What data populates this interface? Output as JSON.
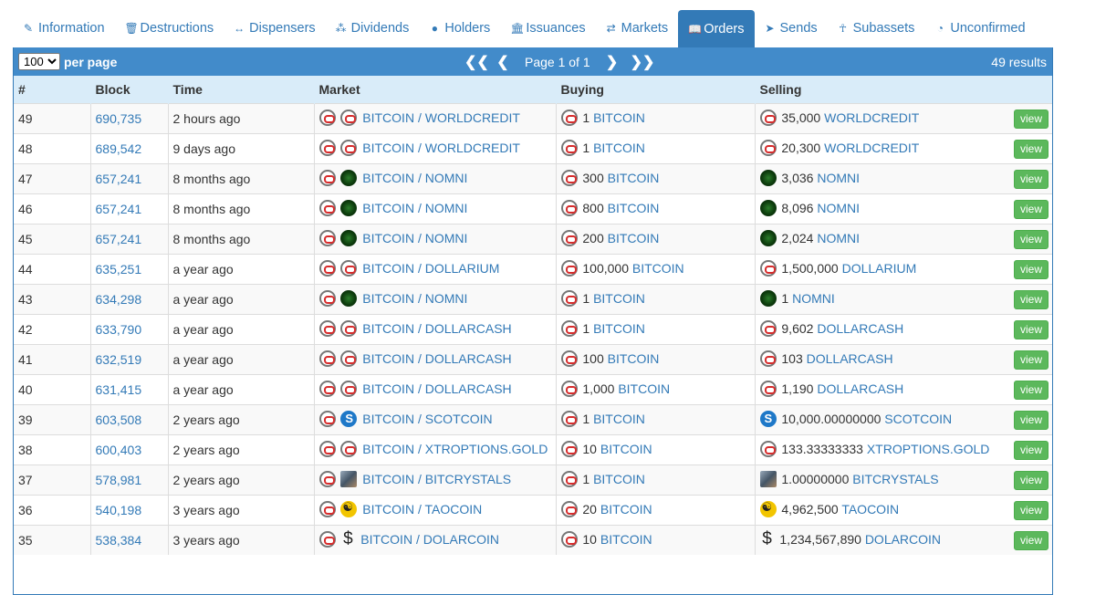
{
  "tabs": [
    {
      "label": "Information",
      "icon": "file-icon",
      "glyph": "✎"
    },
    {
      "label": "Destructions",
      "icon": "trash-icon",
      "glyph": "🗑"
    },
    {
      "label": "Dispensers",
      "icon": "arrows-h-icon",
      "glyph": "↔"
    },
    {
      "label": "Dividends",
      "icon": "sitemap-icon",
      "glyph": "⁂"
    },
    {
      "label": "Holders",
      "icon": "user-icon",
      "glyph": "●"
    },
    {
      "label": "Issuances",
      "icon": "bank-icon",
      "glyph": "🏛"
    },
    {
      "label": "Markets",
      "icon": "exchange-icon",
      "glyph": "⇄"
    },
    {
      "label": "Orders",
      "icon": "book-icon",
      "glyph": "📖"
    },
    {
      "label": "Sends",
      "icon": "paper-plane-icon",
      "glyph": "➤"
    },
    {
      "label": "Subassets",
      "icon": "child-icon",
      "glyph": "☥"
    },
    {
      "label": "Unconfirmed",
      "icon": "clock-icon",
      "glyph": "◔"
    }
  ],
  "active_tab": "Orders",
  "toolbar": {
    "per_page_value": "100",
    "per_page_label": "per page",
    "page_text": "Page 1 of 1",
    "results_text": "49 results",
    "first_glyph": "❮❮",
    "prev_glyph": "❮",
    "next_glyph": "❯",
    "last_glyph": "❯❯"
  },
  "columns": [
    "#",
    "Block",
    "Time",
    "Market",
    "Buying",
    "Selling"
  ],
  "view_label": "view",
  "rows": [
    {
      "num": "49",
      "block": "690,735",
      "time": "2 hours ago",
      "icon_a": "btc",
      "icon_b": "btc",
      "market": "BITCOIN / WORLDCREDIT",
      "buy_icon": "btc",
      "buy_amt": "1",
      "buy_asset": "BITCOIN",
      "sell_icon": "btc",
      "sell_amt": "35,000",
      "sell_asset": "WORLDCREDIT"
    },
    {
      "num": "48",
      "block": "689,542",
      "time": "9 days ago",
      "icon_a": "btc",
      "icon_b": "btc",
      "market": "BITCOIN / WORLDCREDIT",
      "buy_icon": "btc",
      "buy_amt": "1",
      "buy_asset": "BITCOIN",
      "sell_icon": "btc",
      "sell_amt": "20,300",
      "sell_asset": "WORLDCREDIT"
    },
    {
      "num": "47",
      "block": "657,241",
      "time": "8 months ago",
      "icon_a": "btc",
      "icon_b": "nomni",
      "market": "BITCOIN / NOMNI",
      "buy_icon": "btc",
      "buy_amt": "300",
      "buy_asset": "BITCOIN",
      "sell_icon": "nomni",
      "sell_amt": "3,036",
      "sell_asset": "NOMNI"
    },
    {
      "num": "46",
      "block": "657,241",
      "time": "8 months ago",
      "icon_a": "btc",
      "icon_b": "nomni",
      "market": "BITCOIN / NOMNI",
      "buy_icon": "btc",
      "buy_amt": "800",
      "buy_asset": "BITCOIN",
      "sell_icon": "nomni",
      "sell_amt": "8,096",
      "sell_asset": "NOMNI"
    },
    {
      "num": "45",
      "block": "657,241",
      "time": "8 months ago",
      "icon_a": "btc",
      "icon_b": "nomni",
      "market": "BITCOIN / NOMNI",
      "buy_icon": "btc",
      "buy_amt": "200",
      "buy_asset": "BITCOIN",
      "sell_icon": "nomni",
      "sell_amt": "2,024",
      "sell_asset": "NOMNI"
    },
    {
      "num": "44",
      "block": "635,251",
      "time": "a year ago",
      "icon_a": "btc",
      "icon_b": "btc",
      "market": "BITCOIN / DOLLARIUM",
      "buy_icon": "btc",
      "buy_amt": "100,000",
      "buy_asset": "BITCOIN",
      "sell_icon": "btc",
      "sell_amt": "1,500,000",
      "sell_asset": "DOLLARIUM"
    },
    {
      "num": "43",
      "block": "634,298",
      "time": "a year ago",
      "icon_a": "btc",
      "icon_b": "nomni",
      "market": "BITCOIN / NOMNI",
      "buy_icon": "btc",
      "buy_amt": "1",
      "buy_asset": "BITCOIN",
      "sell_icon": "nomni",
      "sell_amt": "1",
      "sell_asset": "NOMNI"
    },
    {
      "num": "42",
      "block": "633,790",
      "time": "a year ago",
      "icon_a": "btc",
      "icon_b": "btc",
      "market": "BITCOIN / DOLLARCASH",
      "buy_icon": "btc",
      "buy_amt": "1",
      "buy_asset": "BITCOIN",
      "sell_icon": "btc",
      "sell_amt": "9,602",
      "sell_asset": "DOLLARCASH"
    },
    {
      "num": "41",
      "block": "632,519",
      "time": "a year ago",
      "icon_a": "btc",
      "icon_b": "btc",
      "market": "BITCOIN / DOLLARCASH",
      "buy_icon": "btc",
      "buy_amt": "100",
      "buy_asset": "BITCOIN",
      "sell_icon": "btc",
      "sell_amt": "103",
      "sell_asset": "DOLLARCASH"
    },
    {
      "num": "40",
      "block": "631,415",
      "time": "a year ago",
      "icon_a": "btc",
      "icon_b": "btc",
      "market": "BITCOIN / DOLLARCASH",
      "buy_icon": "btc",
      "buy_amt": "1,000",
      "buy_asset": "BITCOIN",
      "sell_icon": "btc",
      "sell_amt": "1,190",
      "sell_asset": "DOLLARCASH"
    },
    {
      "num": "39",
      "block": "603,508",
      "time": "2 years ago",
      "icon_a": "btc",
      "icon_b": "scot",
      "market": "BITCOIN / SCOTCOIN",
      "buy_icon": "btc",
      "buy_amt": "1",
      "buy_asset": "BITCOIN",
      "sell_icon": "scot",
      "sell_amt": "10,000.00000000",
      "sell_asset": "SCOTCOIN"
    },
    {
      "num": "38",
      "block": "600,403",
      "time": "2 years ago",
      "icon_a": "btc",
      "icon_b": "btc",
      "market": "BITCOIN / XTROPTIONS.GOLD",
      "buy_icon": "btc",
      "buy_amt": "10",
      "buy_asset": "BITCOIN",
      "sell_icon": "btc",
      "sell_amt": "133.33333333",
      "sell_asset": "XTROPTIONS.GOLD"
    },
    {
      "num": "37",
      "block": "578,981",
      "time": "2 years ago",
      "icon_a": "btc",
      "icon_b": "cube",
      "market": "BITCOIN / BITCRYSTALS",
      "buy_icon": "btc",
      "buy_amt": "1",
      "buy_asset": "BITCOIN",
      "sell_icon": "cube",
      "sell_amt": "1.00000000",
      "sell_asset": "BITCRYSTALS"
    },
    {
      "num": "36",
      "block": "540,198",
      "time": "3 years ago",
      "icon_a": "btc",
      "icon_b": "tao",
      "market": "BITCOIN / TAOCOIN",
      "buy_icon": "btc",
      "buy_amt": "20",
      "buy_asset": "BITCOIN",
      "sell_icon": "tao",
      "sell_amt": "4,962,500",
      "sell_asset": "TAOCOIN"
    },
    {
      "num": "35",
      "block": "538,384",
      "time": "3 years ago",
      "icon_a": "btc",
      "icon_b": "dol",
      "market": "BITCOIN / DOLARCOIN",
      "buy_icon": "btc",
      "buy_amt": "10",
      "buy_asset": "BITCOIN",
      "sell_icon": "dol",
      "sell_amt": "1,234,567,890",
      "sell_asset": "DOLARCOIN"
    }
  ]
}
